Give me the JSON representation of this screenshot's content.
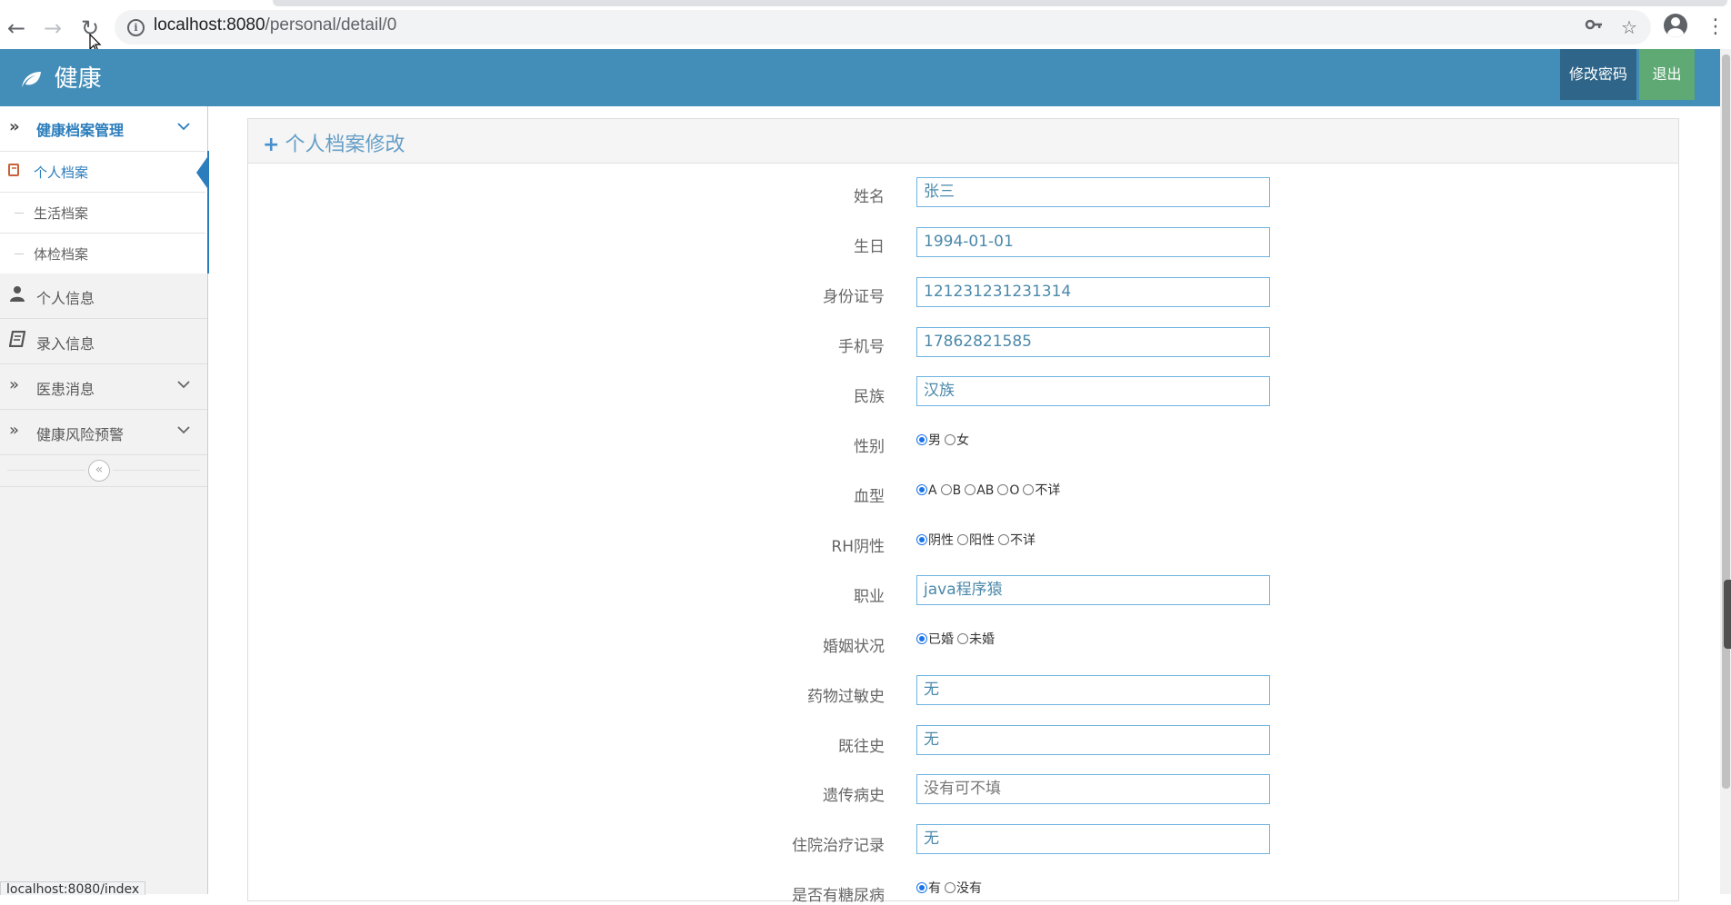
{
  "browser": {
    "url_host": "localhost:8080",
    "url_path": "/personal/detail/0",
    "status_url": "localhost:8080/index"
  },
  "header": {
    "brand": "健康",
    "change_password": "修改密码",
    "logout": "退出"
  },
  "sidebar": {
    "groups": [
      {
        "label": "健康档案管理",
        "icon": "double-chevron-icon",
        "open": true
      },
      {
        "label": "个人信息",
        "icon": "user-icon"
      },
      {
        "label": "录入信息",
        "icon": "book-icon"
      },
      {
        "label": "医患消息",
        "icon": "double-chevron-icon"
      },
      {
        "label": "健康风险预警",
        "icon": "double-chevron-icon"
      }
    ],
    "subitems": [
      {
        "label": "个人档案",
        "active": true
      },
      {
        "label": "生活档案"
      },
      {
        "label": "体检档案"
      }
    ]
  },
  "panel": {
    "title": "个人档案修改"
  },
  "form": {
    "name": {
      "label": "姓名",
      "value": "张三"
    },
    "birthday": {
      "label": "生日",
      "value": "1994-01-01"
    },
    "id_number": {
      "label": "身份证号",
      "value": "121231231231314"
    },
    "phone": {
      "label": "手机号",
      "value": "17862821585"
    },
    "ethnicity": {
      "label": "民族",
      "value": "汉族"
    },
    "gender": {
      "label": "性别",
      "options": [
        "男",
        "女"
      ],
      "selected": "男"
    },
    "blood_type": {
      "label": "血型",
      "options": [
        "A",
        "B",
        "AB",
        "O",
        "不详"
      ],
      "selected": "A"
    },
    "rh": {
      "label": "RH阴性",
      "options": [
        "阴性",
        "阳性",
        "不详"
      ],
      "selected": "阴性"
    },
    "occupation": {
      "label": "职业",
      "value": "java程序猿"
    },
    "marital": {
      "label": "婚姻状况",
      "options": [
        "已婚",
        "未婚"
      ],
      "selected": "已婚"
    },
    "drug_allergy": {
      "label": "药物过敏史",
      "value": "无"
    },
    "medical_history": {
      "label": "既往史",
      "value": "无"
    },
    "hereditary": {
      "label": "遗传病史",
      "placeholder": "没有可不填"
    },
    "hospitalization": {
      "label": "住院治疗记录",
      "value": "无"
    },
    "diabetes": {
      "label": "是否有糖尿病",
      "options": [
        "有",
        "没有"
      ],
      "selected": "有"
    }
  },
  "colors": {
    "header_bg": "#438eb9",
    "accent": "#2b7dbc",
    "logout_bg": "#5ea974",
    "password_bg": "#2e6589"
  }
}
